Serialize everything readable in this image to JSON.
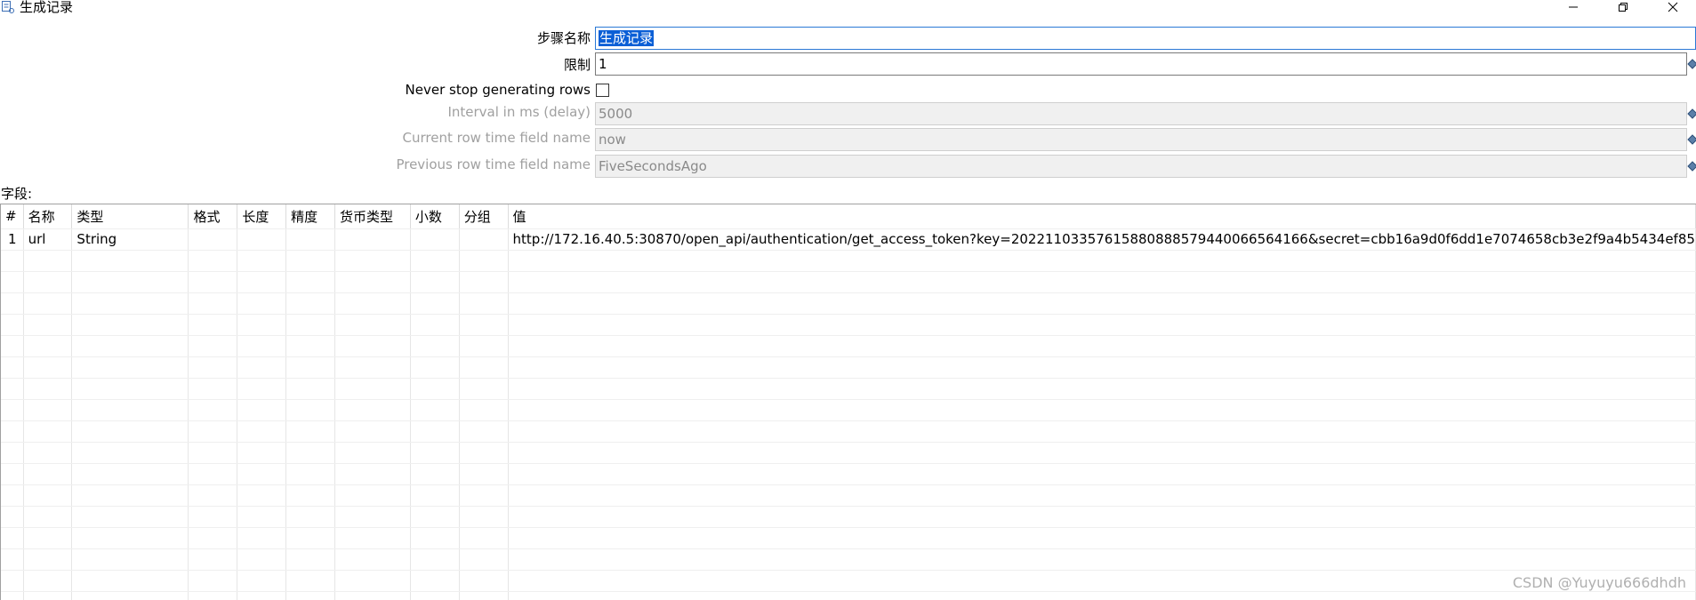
{
  "window": {
    "title": "生成记录",
    "icon": "dialog-icon",
    "controls": [
      "minimize-icon",
      "restore-icon",
      "close-icon"
    ]
  },
  "form": {
    "step_name_label": "步骤名称",
    "step_name_value": "生成记录",
    "limit_label": "限制",
    "limit_value": "1",
    "never_stop_label": "Never stop generating rows",
    "never_stop_checked": false,
    "interval_label": "Interval in ms (delay)",
    "interval_value": "5000",
    "current_time_label": "Current row time field name",
    "current_time_value": "now",
    "previous_time_label": "Previous row time field name",
    "previous_time_value": "FiveSecondsAgo"
  },
  "fields": {
    "section_label": "字段:",
    "columns": [
      "#",
      "名称",
      "类型",
      "格式",
      "长度",
      "精度",
      "货币类型",
      "小数",
      "分组",
      "值"
    ],
    "rows": [
      {
        "num": "1",
        "name": "url",
        "type": "String",
        "format": "",
        "length": "",
        "precision": "",
        "currency": "",
        "decimal": "",
        "group": "",
        "value": "http://172.16.40.5:30870/open_api/authentication/get_access_token?key=20221103357615880888579440066564166&secret=cbb16a9d0f6dd1e7074658cb3e2f9a4b5434ef85"
      }
    ]
  },
  "watermark": "CSDN @Yuyuyu666dhdh"
}
